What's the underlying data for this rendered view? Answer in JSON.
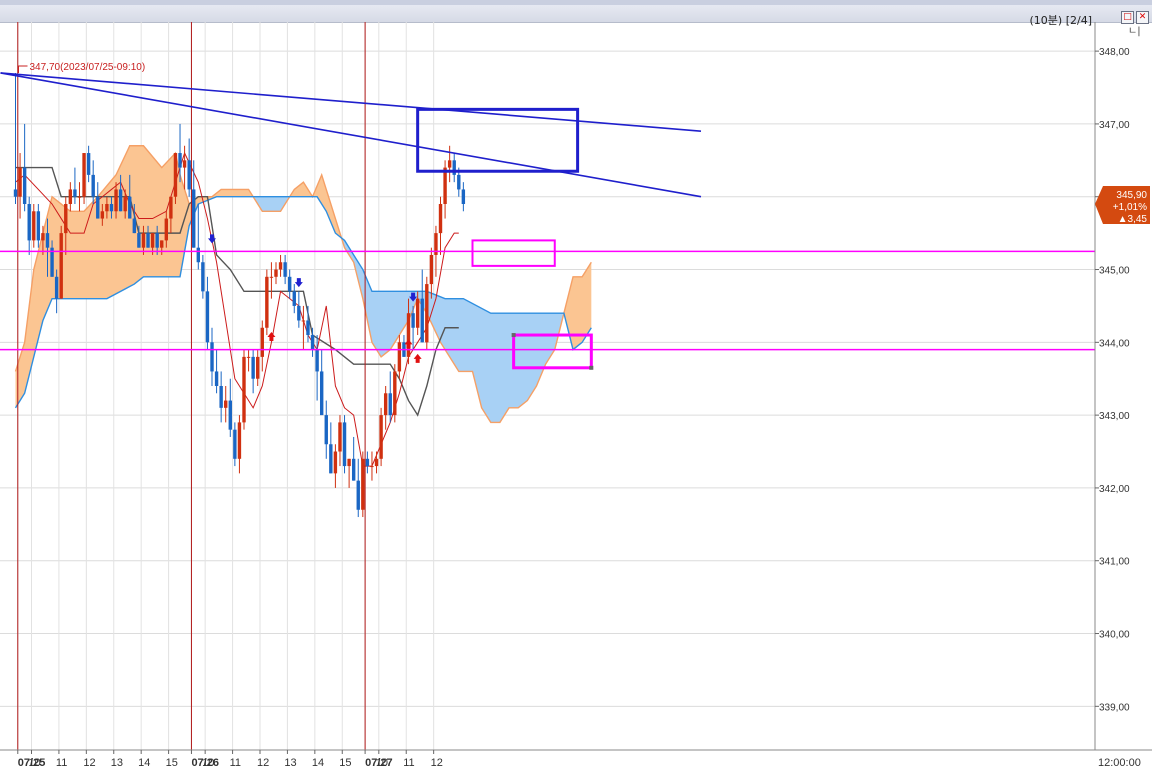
{
  "window": {
    "title": "(10분) [2/4]",
    "corner_label": "ㄴ|",
    "btn_restore": "□",
    "btn_close": "✕"
  },
  "colors": {
    "up": "#d03010",
    "down": "#1a66c4",
    "tenkan": "#cc1b1b",
    "kijun": "#555555",
    "span_a": "#f5a066",
    "span_b": "#2f8fe0",
    "cloud_up": "#fbc592",
    "cloud_down": "#a8d1f5",
    "trendline": "#1f1fcc",
    "hline": "#ff00ff",
    "session": "#b01818",
    "price_tag": "#d44a10"
  },
  "chart_data": {
    "type": "candlestick",
    "ylim": [
      338.4,
      348.4
    ],
    "y_ticks": [
      "348,00",
      "347,00",
      "346,00",
      "345,00",
      "344,00",
      "343,00",
      "342,00",
      "341,00",
      "340,00",
      "339,00"
    ],
    "y_tick_values": [
      348,
      347,
      346,
      345,
      344,
      343,
      342,
      341,
      340,
      339
    ],
    "x_ticks": [
      {
        "i": 0.5,
        "label": "07/25",
        "bold": true
      },
      {
        "i": 3.5,
        "label": "10"
      },
      {
        "i": 9.5,
        "label": "11"
      },
      {
        "i": 15.5,
        "label": "12"
      },
      {
        "i": 21.5,
        "label": "13"
      },
      {
        "i": 27.5,
        "label": "14"
      },
      {
        "i": 33.5,
        "label": "15"
      },
      {
        "i": 38.5,
        "label": "07/26",
        "bold": true
      },
      {
        "i": 41.5,
        "label": "10"
      },
      {
        "i": 47.5,
        "label": "11"
      },
      {
        "i": 53.5,
        "label": "12"
      },
      {
        "i": 59.5,
        "label": "13"
      },
      {
        "i": 65.5,
        "label": "14"
      },
      {
        "i": 71.5,
        "label": "15"
      },
      {
        "i": 76.5,
        "label": "07/27",
        "bold": true
      },
      {
        "i": 79.5,
        "label": "10"
      },
      {
        "i": 85.5,
        "label": "11"
      },
      {
        "i": 91.5,
        "label": "12"
      },
      {
        "i": 146,
        "label": "12:00:00"
      }
    ],
    "session_breaks": [
      1,
      39,
      77
    ],
    "candles": [
      [
        346.1,
        347.7,
        345.9,
        346.0
      ],
      [
        346.0,
        346.6,
        345.7,
        346.4
      ],
      [
        346.4,
        347.0,
        345.8,
        345.9
      ],
      [
        345.9,
        346.0,
        345.2,
        345.4
      ],
      [
        345.4,
        345.9,
        345.3,
        345.8
      ],
      [
        345.8,
        345.9,
        345.3,
        345.4
      ],
      [
        345.4,
        345.6,
        345.2,
        345.5
      ],
      [
        345.5,
        345.7,
        344.9,
        345.3
      ],
      [
        345.3,
        345.4,
        344.9,
        344.9
      ],
      [
        344.9,
        345.0,
        344.4,
        344.6
      ],
      [
        344.6,
        345.6,
        344.6,
        345.5
      ],
      [
        345.5,
        346.0,
        345.2,
        345.9
      ],
      [
        345.9,
        346.2,
        345.8,
        346.1
      ],
      [
        346.1,
        346.4,
        345.9,
        346.0
      ],
      [
        346.0,
        346.2,
        345.8,
        346.0
      ],
      [
        346.0,
        346.6,
        345.9,
        346.6
      ],
      [
        346.6,
        346.7,
        346.2,
        346.3
      ],
      [
        346.3,
        346.5,
        345.9,
        346.0
      ],
      [
        346.0,
        346.2,
        345.7,
        345.7
      ],
      [
        345.7,
        345.9,
        345.6,
        345.8
      ],
      [
        345.8,
        346.0,
        345.7,
        345.9
      ],
      [
        345.9,
        346.0,
        345.7,
        345.8
      ],
      [
        345.8,
        346.2,
        345.7,
        346.1
      ],
      [
        346.1,
        346.3,
        345.8,
        345.8
      ],
      [
        345.8,
        346.1,
        345.7,
        346.0
      ],
      [
        346.0,
        346.3,
        345.8,
        345.7
      ],
      [
        345.7,
        345.9,
        345.5,
        345.5
      ],
      [
        345.5,
        345.6,
        345.3,
        345.3
      ],
      [
        345.3,
        345.6,
        345.2,
        345.5
      ],
      [
        345.5,
        345.6,
        345.3,
        345.3
      ],
      [
        345.3,
        345.5,
        345.2,
        345.5
      ],
      [
        345.5,
        345.6,
        345.2,
        345.3
      ],
      [
        345.3,
        345.4,
        345.2,
        345.4
      ],
      [
        345.4,
        345.8,
        345.3,
        345.7
      ],
      [
        345.7,
        346.0,
        345.5,
        346.0
      ],
      [
        346.0,
        346.6,
        345.9,
        346.6
      ],
      [
        346.6,
        347.0,
        346.2,
        346.4
      ],
      [
        346.4,
        346.7,
        346.1,
        346.5
      ],
      [
        346.5,
        346.8,
        346.0,
        346.1
      ],
      [
        346.1,
        346.5,
        345.3,
        345.3
      ],
      [
        345.3,
        345.9,
        345.0,
        345.1
      ],
      [
        345.1,
        345.2,
        344.6,
        344.7
      ],
      [
        344.7,
        344.9,
        343.9,
        344.0
      ],
      [
        344.0,
        344.2,
        343.4,
        343.6
      ],
      [
        343.6,
        343.9,
        343.3,
        343.4
      ],
      [
        343.4,
        343.6,
        342.9,
        343.1
      ],
      [
        343.1,
        343.4,
        342.9,
        343.2
      ],
      [
        343.2,
        343.5,
        342.7,
        342.8
      ],
      [
        342.8,
        342.9,
        342.3,
        342.4
      ],
      [
        342.4,
        343.0,
        342.2,
        342.9
      ],
      [
        342.9,
        343.9,
        342.8,
        343.8
      ],
      [
        343.8,
        343.9,
        343.6,
        343.8
      ],
      [
        343.8,
        343.9,
        343.3,
        343.5
      ],
      [
        343.5,
        343.9,
        343.4,
        343.8
      ],
      [
        343.8,
        344.3,
        343.6,
        344.2
      ],
      [
        344.2,
        345.0,
        344.1,
        344.9
      ],
      [
        344.9,
        345.1,
        344.6,
        344.9
      ],
      [
        344.9,
        345.1,
        344.8,
        345.0
      ],
      [
        345.0,
        345.2,
        344.9,
        345.1
      ],
      [
        345.1,
        345.2,
        344.8,
        344.9
      ],
      [
        344.9,
        345.0,
        344.6,
        344.7
      ],
      [
        344.7,
        344.8,
        344.4,
        344.5
      ],
      [
        344.5,
        344.7,
        344.2,
        344.3
      ],
      [
        344.3,
        344.5,
        343.9,
        344.3
      ],
      [
        344.3,
        344.5,
        344.0,
        344.1
      ],
      [
        344.1,
        344.2,
        343.8,
        343.9
      ],
      [
        343.9,
        344.1,
        343.2,
        343.6
      ],
      [
        343.6,
        343.9,
        343.1,
        343.0
      ],
      [
        343.0,
        343.2,
        342.4,
        342.6
      ],
      [
        342.6,
        342.9,
        342.2,
        342.2
      ],
      [
        342.2,
        342.6,
        342.0,
        342.5
      ],
      [
        342.5,
        343.0,
        342.3,
        342.9
      ],
      [
        342.9,
        343.0,
        342.2,
        342.3
      ],
      [
        342.3,
        342.4,
        342.0,
        342.4
      ],
      [
        342.4,
        342.7,
        342.1,
        342.1
      ],
      [
        342.1,
        342.4,
        341.6,
        341.7
      ],
      [
        341.7,
        342.5,
        341.6,
        342.4
      ],
      [
        342.4,
        342.5,
        342.2,
        342.3
      ],
      [
        342.3,
        342.5,
        342.1,
        342.3
      ],
      [
        342.3,
        342.5,
        342.2,
        342.4
      ],
      [
        342.4,
        343.1,
        342.3,
        343.0
      ],
      [
        343.0,
        343.4,
        342.8,
        343.3
      ],
      [
        343.3,
        343.6,
        342.9,
        343.0
      ],
      [
        343.0,
        343.7,
        342.9,
        343.6
      ],
      [
        343.6,
        344.1,
        343.5,
        344.0
      ],
      [
        344.0,
        344.1,
        343.8,
        343.8
      ],
      [
        343.8,
        344.6,
        343.7,
        344.4
      ],
      [
        344.4,
        344.5,
        343.9,
        344.2
      ],
      [
        344.2,
        344.7,
        344.1,
        344.6
      ],
      [
        344.6,
        345.0,
        344.0,
        344.0
      ],
      [
        344.0,
        344.9,
        343.9,
        344.8
      ],
      [
        344.8,
        345.3,
        344.6,
        345.2
      ],
      [
        345.2,
        345.6,
        344.9,
        345.5
      ],
      [
        345.5,
        346.0,
        345.2,
        345.9
      ],
      [
        345.9,
        346.5,
        345.7,
        346.4
      ],
      [
        346.4,
        346.7,
        346.2,
        346.5
      ],
      [
        346.5,
        346.6,
        346.2,
        346.3
      ],
      [
        346.3,
        346.4,
        346.0,
        346.1
      ],
      [
        346.1,
        346.2,
        345.8,
        345.9
      ]
    ],
    "last_price": "345,90",
    "last_change_pct": "+1,01%",
    "last_change": "▲3,45",
    "high_label": "347,70(2023/07/25-09:10)",
    "high_value": 347.7,
    "high_index": 0,
    "hlines": [
      345.25,
      343.9
    ],
    "trendlines": [
      {
        "from": [
          0,
          347.7
        ],
        "to": [
          150,
          346.9
        ]
      },
      {
        "from": [
          0,
          347.7
        ],
        "to": [
          150,
          346.0
        ]
      }
    ],
    "boxes": [
      {
        "i0": 88,
        "v0": 347.2,
        "i1": 123,
        "v1": 346.35,
        "color": "trendline",
        "width": 3
      },
      {
        "i0": 100,
        "v0": 345.4,
        "i1": 118,
        "v1": 345.05,
        "color": "hline",
        "width": 2
      },
      {
        "i0": 109,
        "v0": 344.1,
        "i1": 126,
        "v1": 343.65,
        "color": "hline",
        "width": 3
      }
    ],
    "signals": [
      {
        "i": 43,
        "v": 345.4,
        "dir": "down"
      },
      {
        "i": 62,
        "v": 344.8,
        "dir": "down"
      },
      {
        "i": 87,
        "v": 344.6,
        "dir": "down"
      },
      {
        "i": 56,
        "v": 344.1,
        "dir": "up"
      },
      {
        "i": 86,
        "v": 344.0,
        "dir": "up"
      },
      {
        "i": 88,
        "v": 343.8,
        "dir": "up"
      }
    ],
    "tenkan": [
      [
        0,
        346.2
      ],
      [
        2,
        346.3
      ],
      [
        5,
        346.1
      ],
      [
        8,
        345.9
      ],
      [
        10,
        345.7
      ],
      [
        12,
        345.5
      ],
      [
        15,
        345.5
      ],
      [
        17,
        345.9
      ],
      [
        19,
        346.0
      ],
      [
        21,
        346.1
      ],
      [
        23,
        346.2
      ],
      [
        25,
        345.9
      ],
      [
        27,
        345.7
      ],
      [
        30,
        345.7
      ],
      [
        33,
        345.8
      ],
      [
        35,
        346.2
      ],
      [
        37,
        346.6
      ],
      [
        40,
        346.2
      ],
      [
        42,
        345.7
      ],
      [
        44,
        345.1
      ],
      [
        46,
        344.3
      ],
      [
        48,
        343.5
      ],
      [
        50,
        343.3
      ],
      [
        52,
        343.1
      ],
      [
        54,
        343.4
      ],
      [
        56,
        344.0
      ],
      [
        58,
        344.7
      ],
      [
        60,
        344.6
      ],
      [
        62,
        344.5
      ],
      [
        64,
        344.1
      ],
      [
        66,
        343.9
      ],
      [
        68,
        344.5
      ],
      [
        70,
        343.4
      ],
      [
        72,
        343.1
      ],
      [
        74,
        343.0
      ],
      [
        76,
        342.3
      ],
      [
        78,
        342.3
      ],
      [
        80,
        342.6
      ],
      [
        82,
        342.9
      ],
      [
        84,
        343.3
      ],
      [
        86,
        343.8
      ],
      [
        88,
        344.0
      ],
      [
        90,
        344.2
      ],
      [
        92,
        344.6
      ],
      [
        94,
        345.3
      ],
      [
        96,
        345.5
      ],
      [
        97,
        345.5
      ]
    ],
    "kijun": [
      [
        0,
        346.4
      ],
      [
        8,
        346.4
      ],
      [
        10,
        346.0
      ],
      [
        25,
        346.0
      ],
      [
        27,
        345.5
      ],
      [
        36,
        345.5
      ],
      [
        38,
        345.9
      ],
      [
        40,
        346.0
      ],
      [
        42,
        346.0
      ],
      [
        44,
        345.2
      ],
      [
        47,
        345.0
      ],
      [
        50,
        344.7
      ],
      [
        55,
        344.7
      ],
      [
        63,
        344.7
      ],
      [
        65,
        344.1
      ],
      [
        70,
        343.9
      ],
      [
        74,
        343.7
      ],
      [
        80,
        343.7
      ],
      [
        82,
        343.7
      ],
      [
        84,
        343.5
      ],
      [
        86,
        343.2
      ],
      [
        88,
        343.0
      ],
      [
        90,
        343.4
      ],
      [
        92,
        343.9
      ],
      [
        94,
        344.2
      ],
      [
        97,
        344.2
      ]
    ],
    "span_a": [
      [
        0,
        343.6
      ],
      [
        2,
        344.0
      ],
      [
        4,
        345.0
      ],
      [
        6,
        345.5
      ],
      [
        8,
        346.0
      ],
      [
        12,
        345.8
      ],
      [
        15,
        345.8
      ],
      [
        18,
        346.0
      ],
      [
        22,
        346.3
      ],
      [
        25,
        346.7
      ],
      [
        28,
        346.7
      ],
      [
        32,
        346.4
      ],
      [
        35,
        346.6
      ],
      [
        36,
        346.3
      ],
      [
        38,
        345.9
      ],
      [
        40,
        346.0
      ],
      [
        43,
        346.0
      ],
      [
        45,
        346.1
      ],
      [
        48,
        346.1
      ],
      [
        51,
        346.1
      ],
      [
        54,
        345.8
      ],
      [
        58,
        345.8
      ],
      [
        61,
        346.1
      ],
      [
        63,
        346.2
      ],
      [
        65,
        346.0
      ],
      [
        67,
        346.3
      ],
      [
        68,
        346.1
      ],
      [
        70,
        345.7
      ],
      [
        72,
        345.3
      ],
      [
        74,
        345.1
      ],
      [
        76,
        344.6
      ],
      [
        78,
        344.0
      ],
      [
        80,
        343.8
      ],
      [
        82,
        343.9
      ],
      [
        84,
        344.1
      ],
      [
        86,
        344.3
      ],
      [
        88,
        344.6
      ],
      [
        90,
        344.4
      ],
      [
        93,
        344.0
      ],
      [
        95,
        343.8
      ],
      [
        97,
        343.6
      ],
      [
        100,
        343.6
      ],
      [
        102,
        343.1
      ],
      [
        104,
        342.9
      ],
      [
        106,
        342.9
      ],
      [
        108,
        343.1
      ],
      [
        110,
        343.1
      ],
      [
        112,
        343.2
      ],
      [
        114,
        343.4
      ],
      [
        116,
        343.7
      ],
      [
        118,
        343.9
      ],
      [
        120,
        344.4
      ],
      [
        122,
        344.9
      ],
      [
        124,
        344.9
      ],
      [
        126,
        345.1
      ]
    ],
    "span_b": [
      [
        0,
        343.1
      ],
      [
        2,
        343.3
      ],
      [
        4,
        343.8
      ],
      [
        6,
        344.3
      ],
      [
        8,
        344.6
      ],
      [
        12,
        344.6
      ],
      [
        20,
        344.6
      ],
      [
        26,
        344.8
      ],
      [
        28,
        344.9
      ],
      [
        30,
        344.9
      ],
      [
        36,
        344.9
      ],
      [
        38,
        345.6
      ],
      [
        40,
        345.9
      ],
      [
        44,
        346.0
      ],
      [
        50,
        346.0
      ],
      [
        58,
        346.0
      ],
      [
        66,
        346.0
      ],
      [
        68,
        345.8
      ],
      [
        70,
        345.5
      ],
      [
        72,
        345.4
      ],
      [
        74,
        345.2
      ],
      [
        76,
        345.0
      ],
      [
        78,
        344.7
      ],
      [
        90,
        344.7
      ],
      [
        94,
        344.6
      ],
      [
        98,
        344.6
      ],
      [
        104,
        344.4
      ],
      [
        120,
        344.4
      ],
      [
        122,
        343.9
      ],
      [
        124,
        344.0
      ],
      [
        126,
        344.2
      ]
    ]
  }
}
